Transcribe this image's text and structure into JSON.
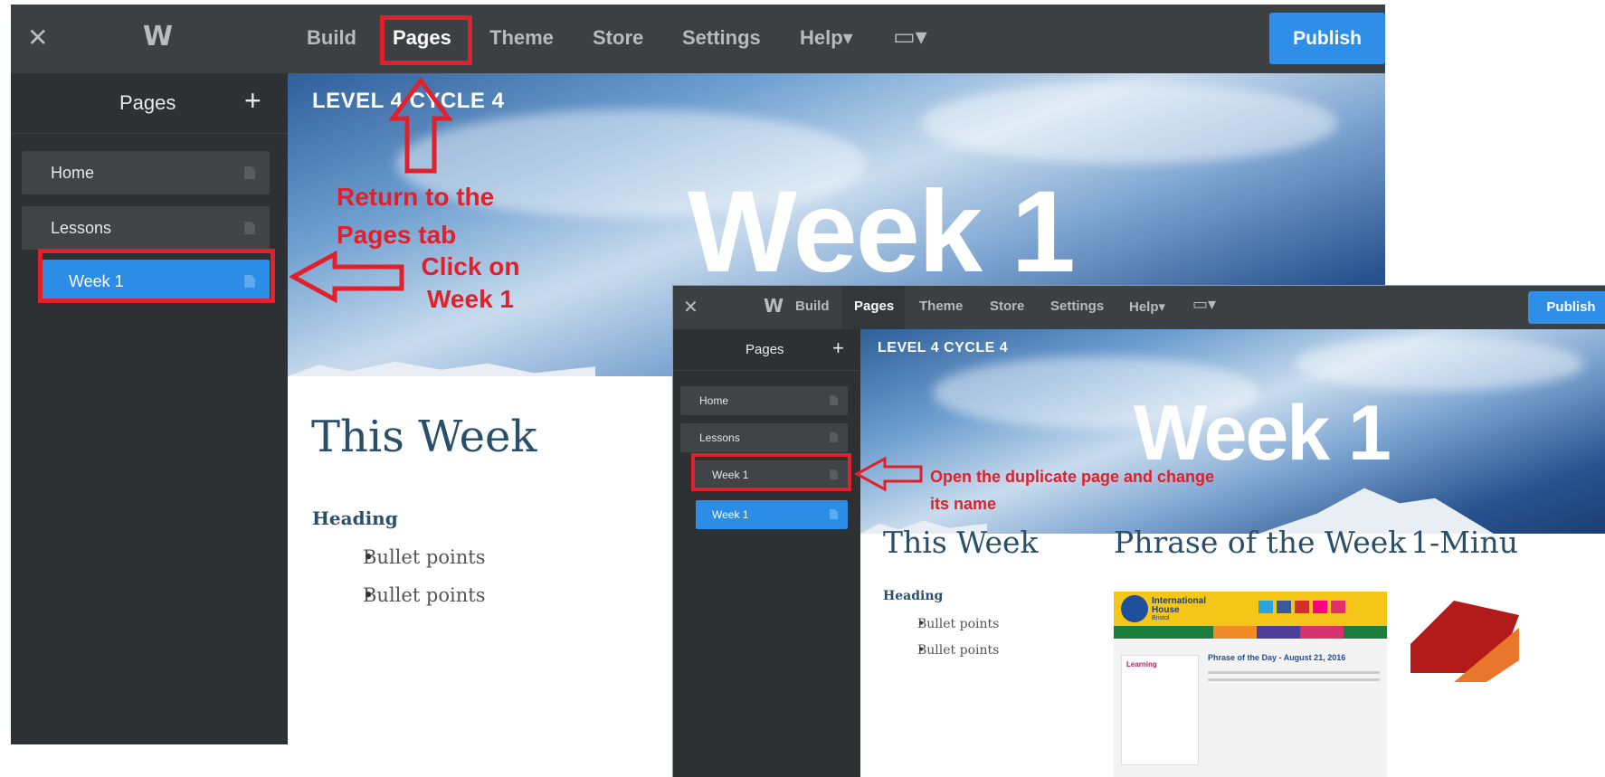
{
  "shotA": {
    "close": "✕",
    "logo": "W",
    "nav": [
      "Build",
      "Pages",
      "Theme",
      "Store",
      "Settings",
      "Help▾"
    ],
    "device": "▭▾",
    "publish": "Publish",
    "sidebar_title": "Pages",
    "add": "+",
    "pages": [
      "Home",
      "Lessons",
      "Week 1"
    ],
    "site_title": "LEVEL 4 CYCLE 4",
    "hero_heading": "Week 1",
    "this_week": "This Week",
    "heading": "Heading",
    "bullets": [
      "Bullet points",
      "Bullet points"
    ],
    "annotation_1": "Return to the Pages tab",
    "annotation_2": "Click on Week 1"
  },
  "shotB": {
    "close": "✕",
    "logo": "W",
    "nav": [
      "Build",
      "Pages",
      "Theme",
      "Store",
      "Settings",
      "Help▾"
    ],
    "device": "▭▾",
    "publish": "Publish",
    "sidebar_title": "Pages",
    "add": "+",
    "pages": [
      "Home",
      "Lessons",
      "Week 1",
      "Week 1"
    ],
    "site_title": "LEVEL 4 CYCLE 4",
    "hero_heading": "Week 1",
    "this_week": "This Week",
    "heading": "Heading",
    "bullets": [
      "Bullet points",
      "Bullet points"
    ],
    "phrase_heading": "Phrase of the Week",
    "minute_heading": "1-Minu",
    "annotation": "Open the duplicate page and change its name",
    "ih": {
      "brand": "International House",
      "city": "Bristol",
      "phrase_title": "Phrase of the Day - August 21, 2016",
      "learning": "Learning"
    }
  },
  "colors": {
    "toolbar": "#3d4043",
    "sidebar": "#2e3133",
    "selected": "#2b8de6",
    "publish": "#2e8ee8",
    "annotation": "#e0202a",
    "heading": "#2a4f6b"
  }
}
